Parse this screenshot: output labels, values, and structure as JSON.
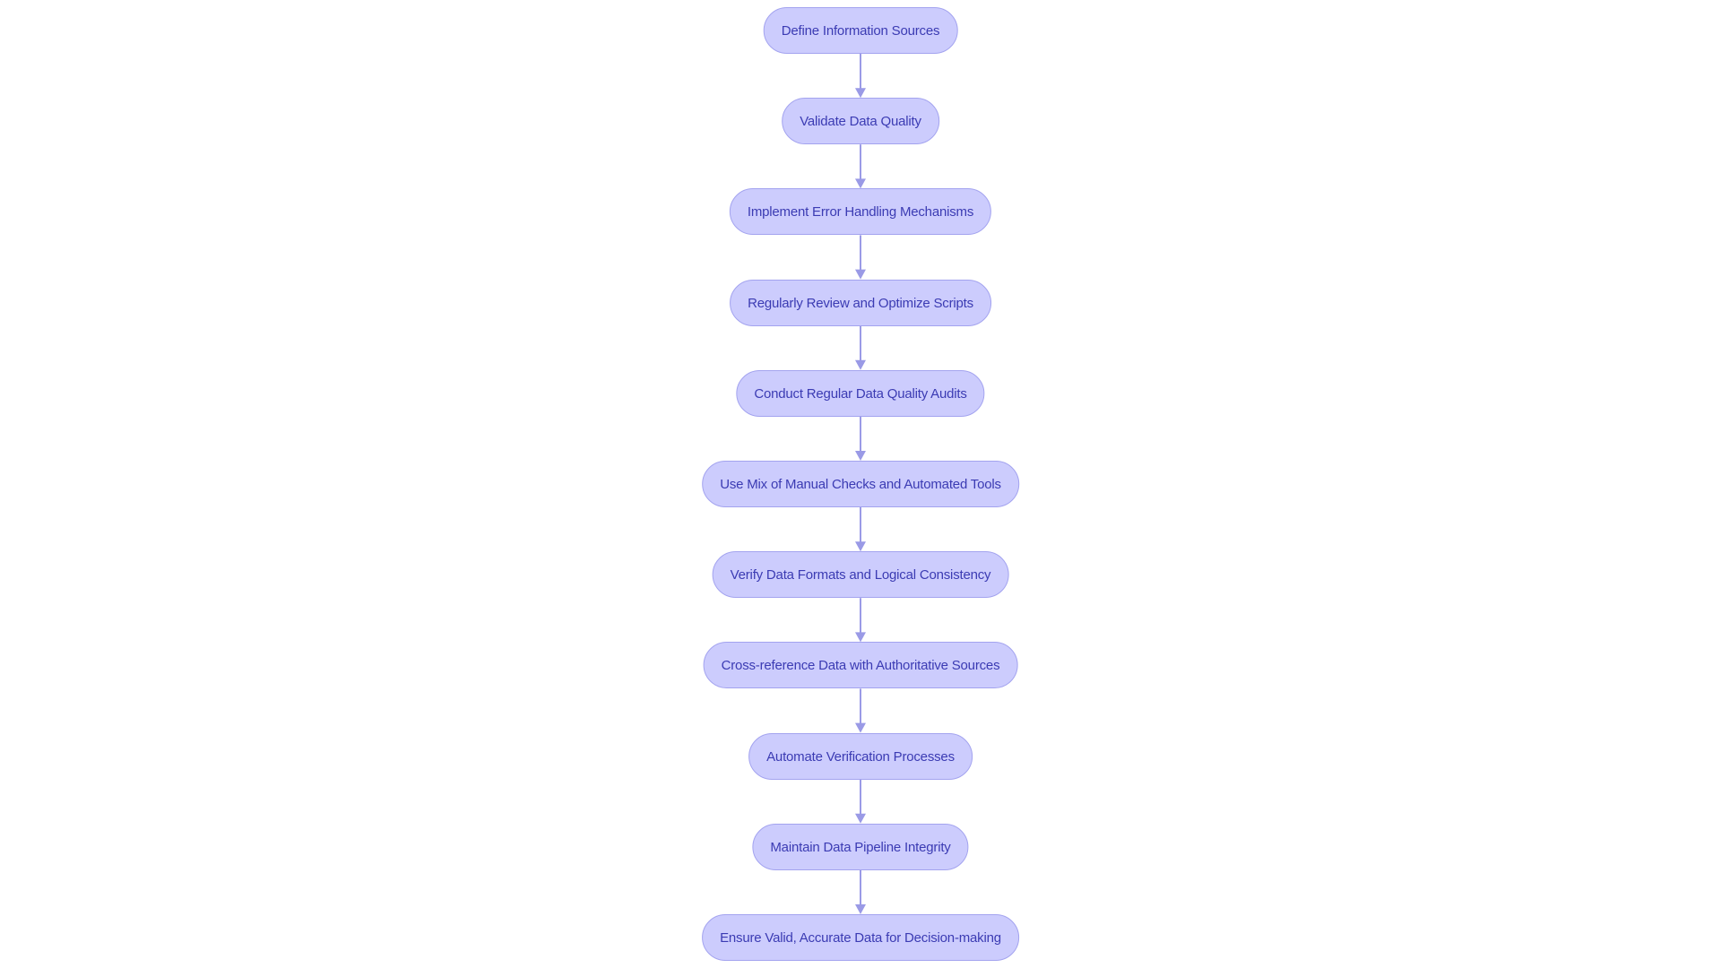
{
  "diagram": {
    "type": "flowchart",
    "direction": "top-down",
    "colors": {
      "node_fill": "#ccccfd",
      "node_border": "#a3a3ef",
      "text": "#3b3bb3",
      "edge": "#9a9ae6"
    },
    "nodes": [
      "Define Information Sources",
      "Validate Data Quality",
      "Implement Error Handling Mechanisms",
      "Regularly Review and Optimize Scripts",
      "Conduct Regular Data Quality Audits",
      "Use Mix of Manual Checks and Automated Tools",
      "Verify Data Formats and Logical Consistency",
      "Cross-reference Data with Authoritative Sources",
      "Automate Verification Processes",
      "Maintain Data Pipeline Integrity",
      "Ensure Valid, Accurate Data for Decision-making"
    ]
  }
}
